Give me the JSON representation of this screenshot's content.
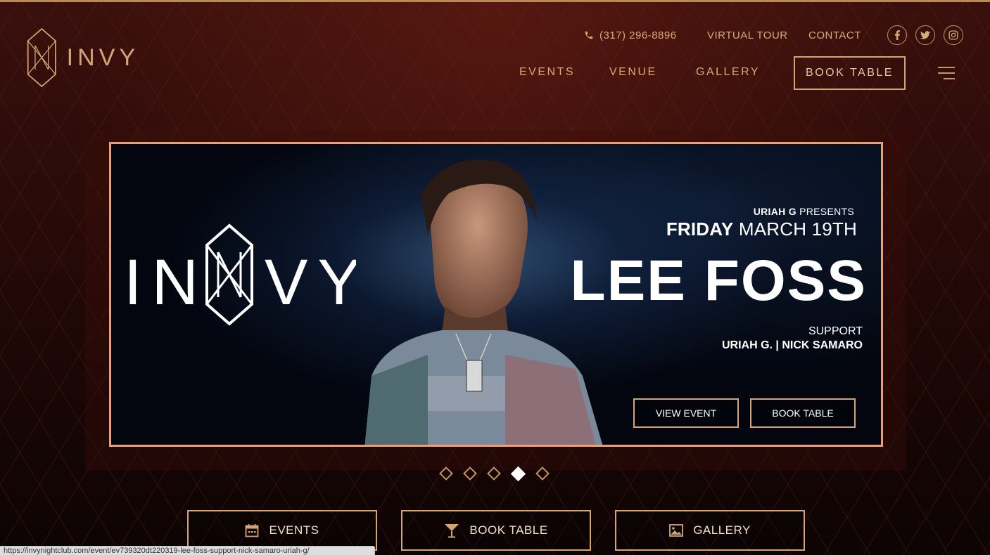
{
  "header": {
    "brand": "INVY",
    "phone": "(317) 296-8896",
    "virtual_tour": "VIRTUAL TOUR",
    "contact": "CONTACT",
    "social": [
      "facebook-icon",
      "twitter-icon",
      "instagram-icon"
    ],
    "nav": {
      "events": "EVENTS",
      "venue": "VENUE",
      "gallery": "GALLERY",
      "book_table": "BOOK TABLE"
    }
  },
  "slide": {
    "logo_text_left": "IN",
    "logo_text_right": "VY",
    "presenter": "URIAH G",
    "presents": "PRESENTS",
    "day": "FRIDAY",
    "date": "MARCH 19TH",
    "headliner": "LEE FOSS",
    "support_label": "SUPPORT",
    "support_acts": "URIAH G.  | NICK SAMARO",
    "view_event": "VIEW EVENT",
    "book_table": "BOOK TABLE"
  },
  "slider": {
    "count": 5,
    "active_index": 3
  },
  "cta": {
    "events": "EVENTS",
    "book_table": "BOOK TABLE",
    "gallery": "GALLERY"
  },
  "status_bar": {
    "url": "https://invynightclub.com/event/ev739320dt220319-lee-foss-support-nick-samaro-uriah-g/"
  },
  "colors": {
    "gold": "#d4a574",
    "frame": "#e6a07a",
    "background": "#2a0b09"
  }
}
